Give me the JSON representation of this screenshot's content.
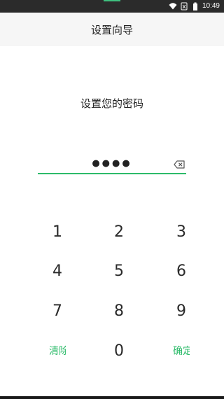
{
  "status_bar": {
    "time": "10:49",
    "icons": [
      "wifi-icon",
      "sim-icon",
      "battery-icon"
    ]
  },
  "header": {
    "title": "设置向导"
  },
  "prompt": {
    "text": "设置您的密码"
  },
  "pin": {
    "masked_value": "●●●●",
    "entered_digits": 4,
    "backspace_icon": "backspace-icon"
  },
  "keypad": {
    "keys": [
      {
        "label": "1",
        "name": "key-1"
      },
      {
        "label": "2",
        "name": "key-2"
      },
      {
        "label": "3",
        "name": "key-3"
      },
      {
        "label": "4",
        "name": "key-4"
      },
      {
        "label": "5",
        "name": "key-5"
      },
      {
        "label": "6",
        "name": "key-6"
      },
      {
        "label": "7",
        "name": "key-7"
      },
      {
        "label": "8",
        "name": "key-8"
      },
      {
        "label": "9",
        "name": "key-9"
      },
      {
        "label": "清除",
        "name": "clear-button"
      },
      {
        "label": "0",
        "name": "key-0"
      },
      {
        "label": "确定",
        "name": "confirm-button"
      }
    ]
  },
  "colors": {
    "accent": "#2dbb6a",
    "title_bar": "#f6f6f6",
    "status_bar": "#2b2b2b"
  }
}
